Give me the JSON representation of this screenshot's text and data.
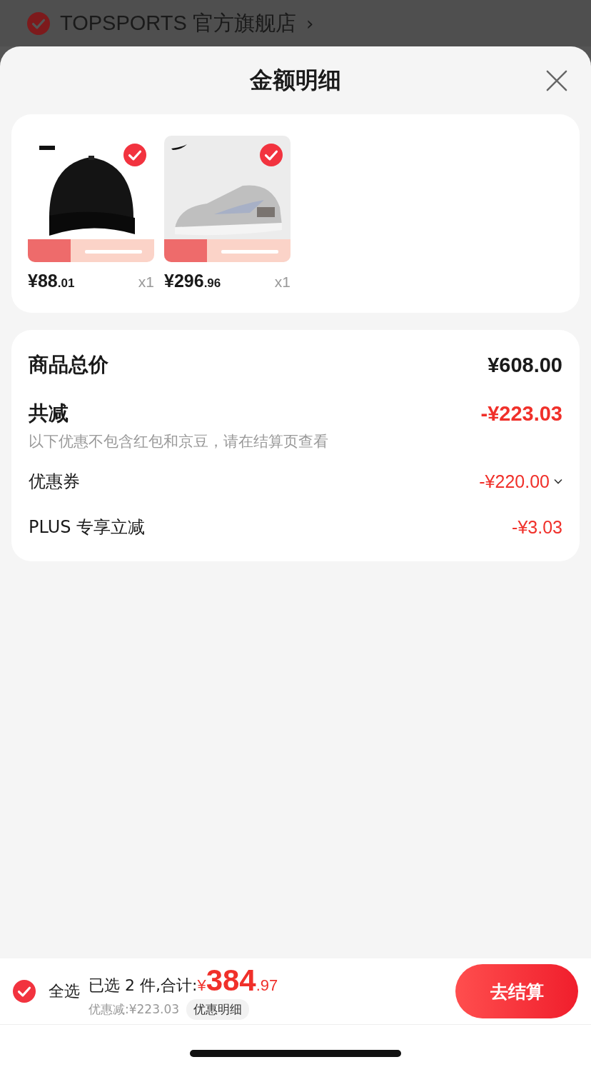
{
  "store": {
    "name": "TOPSPORTS 官方旗舰店",
    "checked": true,
    "arrow": "›"
  },
  "sheet": {
    "title": "金额明细"
  },
  "products": [
    {
      "price": "¥88.01",
      "quantity": "x1",
      "selected": true
    },
    {
      "price": "¥296.96",
      "quantity": "x1",
      "selected": true
    }
  ],
  "summary": [
    {
      "kind": "total",
      "label": "商品总价",
      "value": "¥608.00"
    },
    {
      "kind": "discount",
      "label": "共减",
      "value": "-¥223.03",
      "note": "以下优惠不包含红包和京豆，请在结算页查看"
    },
    {
      "kind": "item",
      "label": "优惠券",
      "value": "-¥220.00",
      "expanded": false
    },
    {
      "kind": "item",
      "label": "PLUS 专享立减",
      "value": "-¥3.03"
    }
  ],
  "footer": {
    "select_all": {
      "label": "全选",
      "checked": true
    },
    "count": "已选 2 件,合计:",
    "total": "¥384.97",
    "saving": "优惠减:¥223.03",
    "detail": "优惠明细",
    "checkout": "去结算"
  }
}
